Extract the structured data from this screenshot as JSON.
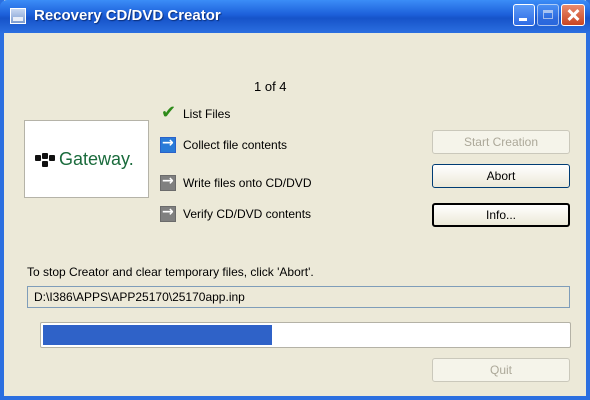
{
  "window": {
    "title": "Recovery CD/DVD Creator"
  },
  "step_counter": "1 of 4",
  "logo": {
    "text": "Gateway."
  },
  "steps": [
    {
      "label": "List Files",
      "state": "done",
      "icon": "checkmark-icon"
    },
    {
      "label": "Collect file contents",
      "state": "active",
      "icon": "arrow-right-icon"
    },
    {
      "label": "Write files onto CD/DVD",
      "state": "pending",
      "icon": "arrow-right-icon"
    },
    {
      "label": "Verify CD/DVD contents",
      "state": "pending",
      "icon": "arrow-right-icon"
    }
  ],
  "buttons": {
    "start": {
      "label": "Start Creation",
      "enabled": false
    },
    "abort": {
      "label": "Abort",
      "enabled": true
    },
    "info": {
      "label": "Info...",
      "enabled": true,
      "focused": true
    },
    "quit": {
      "label": "Quit",
      "enabled": false
    }
  },
  "hint": "To stop Creator and clear temporary files, click 'Abort'.",
  "current_file": "D:\\I386\\APPS\\APP25170\\25170app.inp",
  "progress": {
    "fraction": 0.44
  },
  "colors": {
    "titlebar": "#1c5fd9",
    "progress": "#2f62c8",
    "step_check": "#2e8b1a"
  }
}
